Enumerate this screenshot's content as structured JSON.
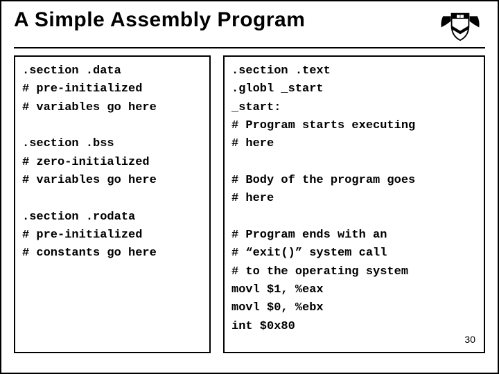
{
  "title": "A Simple Assembly Program",
  "page_number": "30",
  "left": {
    "l1": ".section .data",
    "l2": "# pre-initialized",
    "l3": "# variables go here",
    "l4": ".section .bss",
    "l5": "# zero-initialized",
    "l6": "# variables go here",
    "l7": ".section .rodata",
    "l8": "# pre-initialized",
    "l9": "# constants go here"
  },
  "right": {
    "l1": ".section .text",
    "l2": ".globl _start",
    "l3": "_start:",
    "l4": "# Program starts executing",
    "l5": "# here",
    "l6": "# Body of the program goes",
    "l7": "# here",
    "l8": "# Program ends with an",
    "l9": "# “exit()” system call",
    "l10": "# to the operating system",
    "l11": "movl $1, %eax",
    "l12": "movl $0, %ebx",
    "l13": "int $0x80"
  }
}
